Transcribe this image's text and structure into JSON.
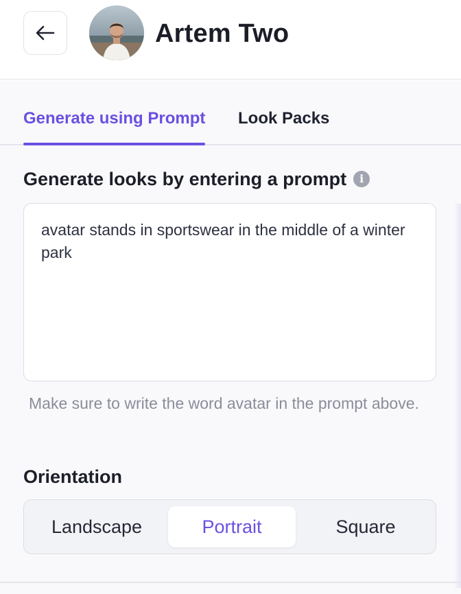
{
  "header": {
    "back_icon": "arrow-left-icon",
    "avatar_icon": "user-avatar",
    "name": "Artem Two"
  },
  "tabs": [
    {
      "label": "Generate using Prompt",
      "active": true
    },
    {
      "label": "Look Packs",
      "active": false
    }
  ],
  "prompt_section": {
    "label": "Generate looks by entering a prompt",
    "info_icon": "info-icon",
    "value": "avatar stands in sportswear in the middle of a winter park",
    "hint": "Make sure to write the word avatar in the prompt above."
  },
  "orientation": {
    "label": "Orientation",
    "options": [
      "Landscape",
      "Portrait",
      "Square"
    ],
    "selected": "Portrait"
  },
  "colors": {
    "accent": "#6b50e0",
    "text": "#1f2230",
    "muted": "#8a8d99",
    "border": "#dcdde3"
  }
}
